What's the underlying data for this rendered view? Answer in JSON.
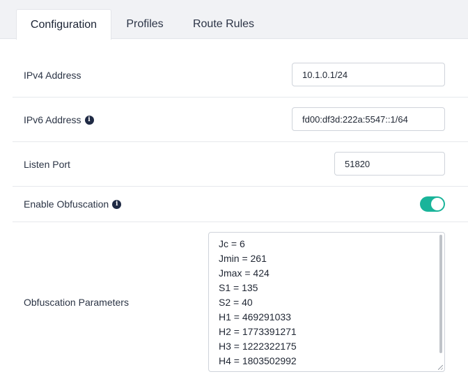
{
  "tabs": [
    {
      "label": "Configuration",
      "active": true
    },
    {
      "label": "Profiles",
      "active": false
    },
    {
      "label": "Route Rules",
      "active": false
    }
  ],
  "fields": {
    "ipv4": {
      "label": "IPv4 Address",
      "value": "10.1.0.1/24"
    },
    "ipv6": {
      "label": "IPv6 Address",
      "value": "fd00:df3d:222a:5547::1/64",
      "icon": "info-icon"
    },
    "listen_port": {
      "label": "Listen Port",
      "value": "51820"
    },
    "obfuscation": {
      "label": "Enable Obfuscation",
      "enabled": true,
      "icon": "info-icon"
    },
    "obfuscation_params": {
      "label": "Obfuscation Parameters",
      "lines": [
        "Jc = 6",
        "Jmin = 261",
        "Jmax = 424",
        "S1 = 135",
        "S2 = 40",
        "H1 = 469291033",
        "H2 = 1773391271",
        "H3 = 1222322175",
        "H4 = 1803502992"
      ]
    }
  },
  "colors": {
    "toggle_on": "#1ab49a",
    "tab_bar": "#f1f2f5",
    "info_icon": "#1f2a44"
  }
}
